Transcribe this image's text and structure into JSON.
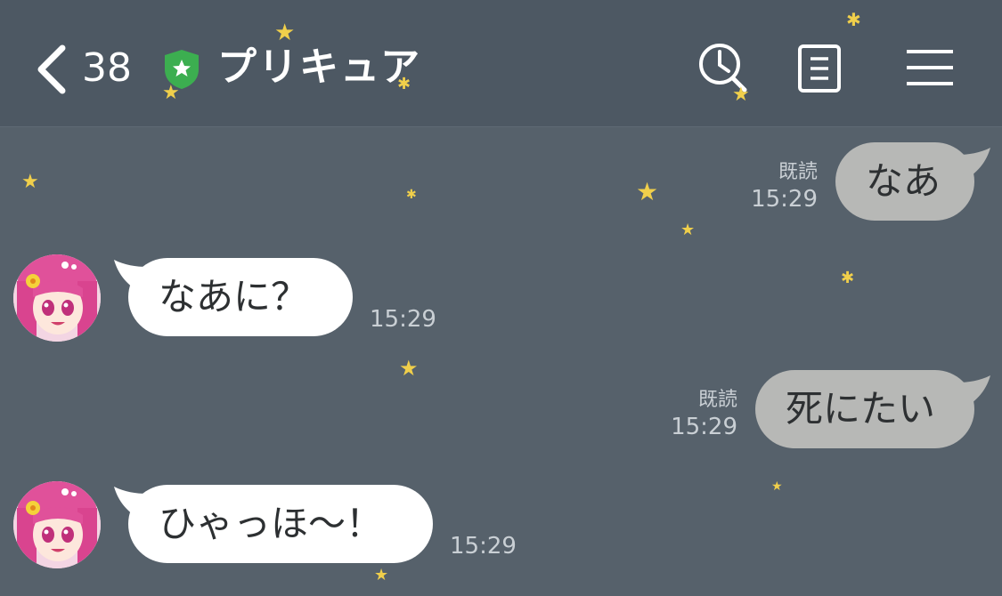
{
  "header": {
    "back_count": "38",
    "title": "プリキュア",
    "back_icon": "chevron-left-icon",
    "badge_icon": "shield-star-icon",
    "actions": [
      "clock-search-icon",
      "notes-icon",
      "menu-icon"
    ]
  },
  "messages": [
    {
      "side": "right",
      "text": "なあ",
      "read": "既読",
      "time": "15:29"
    },
    {
      "side": "left",
      "text": "なあに？",
      "time": "15:29"
    },
    {
      "side": "right",
      "text": "死にたい",
      "read": "既読",
      "time": "15:29"
    },
    {
      "side": "left",
      "text": "ひゃっほ〜！",
      "time": "15:29"
    }
  ],
  "colors": {
    "background": "#56616b",
    "header": "#4d5863",
    "sent_bubble": "#b7b8b6",
    "received_bubble": "#ffffff",
    "star": "#f0cf4b",
    "badge_green": "#3cae50"
  }
}
